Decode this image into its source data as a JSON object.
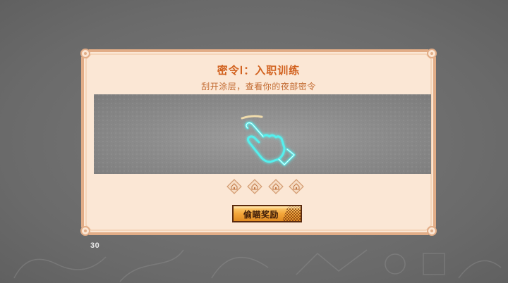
{
  "dialog": {
    "title": "密令Ⅰ：入职训练",
    "subtitle": "刮开涂层，查看你的夜部密令"
  },
  "scratch_area": {
    "icon": "pointing-hand-icon"
  },
  "rewards": [
    {
      "icon": "house-icon"
    },
    {
      "icon": "house-icon"
    },
    {
      "icon": "house-icon"
    },
    {
      "icon": "house-icon"
    }
  ],
  "peek_button": {
    "label": "偷瞄奖励"
  },
  "page_number": "30",
  "colors": {
    "frame_fill": "#fbe7d5",
    "frame_border": "#e7b691",
    "title": "#d2621f",
    "button": "#f0a83a"
  }
}
